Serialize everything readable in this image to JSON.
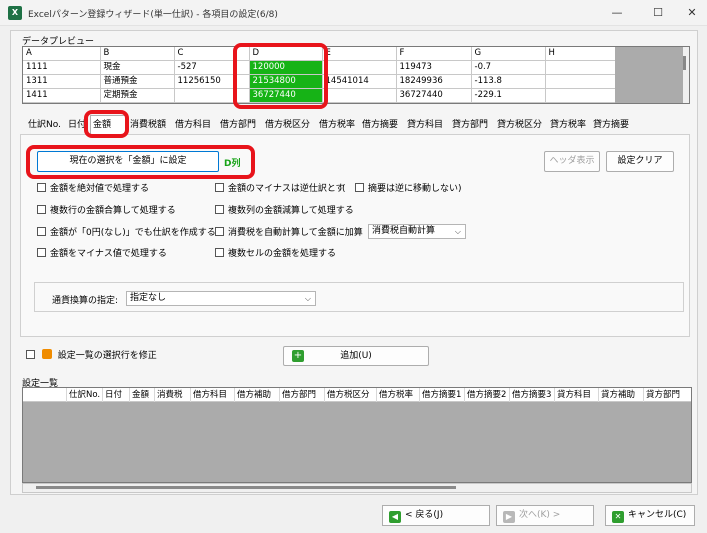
{
  "window": {
    "title": "Excelパターン登録ウィザード(単一仕訳) - 各項目の設定(6/8)",
    "minimize": "—",
    "maximize": "☐",
    "close": "✕"
  },
  "preview": {
    "label": "データプレビュー",
    "columns": [
      "A",
      "B",
      "C",
      "D",
      "E",
      "F",
      "G",
      "H"
    ],
    "rows": [
      [
        "1111",
        "現金",
        "-527",
        "120000",
        "",
        "119473",
        "-0.7",
        ""
      ],
      [
        "1311",
        "普通預金",
        "11256150",
        "21534800",
        "14541014",
        "18249936",
        "-113.8",
        ""
      ],
      [
        "1411",
        "定期預金",
        "",
        "36727440",
        "",
        "36727440",
        "-229.1",
        ""
      ]
    ]
  },
  "tabs": [
    "仕訳No.",
    "日付",
    "金額",
    "消費税額",
    "借方科目",
    "借方部門",
    "借方税区分",
    "借方税率",
    "借方摘要",
    "貸方科目",
    "貸方部門",
    "貸方税区分",
    "貸方税率",
    "貸方摘要"
  ],
  "panel": {
    "set_button": "現在の選択を「金額」に設定",
    "column_tag": "D列",
    "header_display_button": "ヘッダ表示",
    "clear_button": "設定クリア",
    "checkboxes": {
      "abs": "金額を絶対値で処理する",
      "negative_reverse": "金額のマイナスは逆仕訳とす",
      "summary_paren_open": "(",
      "summary_no_move": "摘要は逆に移動しない",
      "summary_paren_close": ")",
      "multi_row_sum": "複数行の金額合算して処理する",
      "multi_col_subtract": "複数列の金額減算して処理する",
      "zero_yen": "金額が「0円(なし)」でも仕訳を作成する",
      "auto_tax": "消費税を自動計算して金額に加算",
      "negative_value": "金額をマイナス値で処理する",
      "multi_cell": "複数セルの金額を処理する"
    },
    "tax_select": "消費税自動計算",
    "currency_label": "通貨換算の指定:",
    "currency_select": "指定なし"
  },
  "modify_selected": "設定一覧の選択行を修正",
  "add_button": "追加(U)",
  "list": {
    "label": "設定一覧",
    "headers": [
      "仕訳No.",
      "日付",
      "金額",
      "消費税",
      "借方科目",
      "借方補助",
      "借方部門",
      "借方税区分",
      "借方税率",
      "借方摘要1",
      "借方摘要2",
      "借方摘要3",
      "貸方科目",
      "貸方補助",
      "貸方部門"
    ]
  },
  "footer": {
    "back": "< 戻る(J)",
    "next": "次へ(K) >",
    "cancel": "キャンセル(C)"
  }
}
